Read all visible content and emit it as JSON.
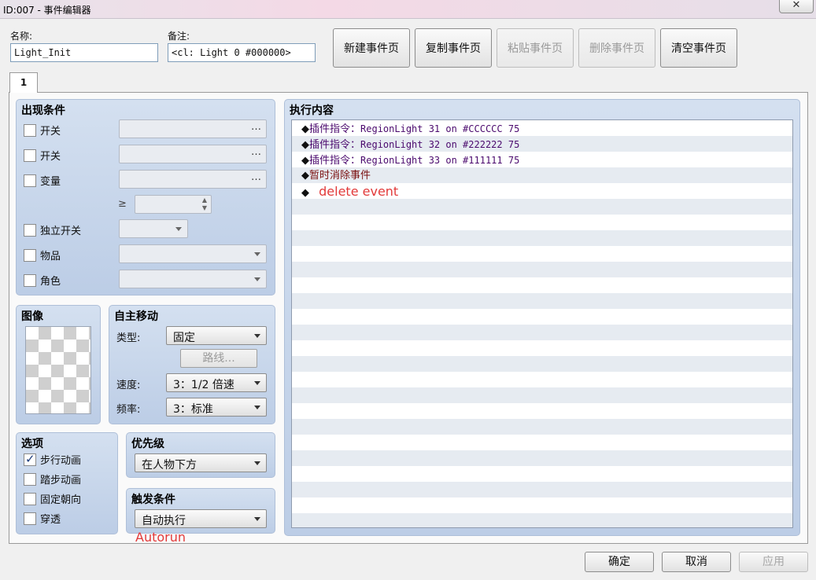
{
  "window": {
    "title": "ID:007 - 事件编辑器",
    "close_glyph": "✕"
  },
  "header": {
    "name_label": "名称:",
    "name_value": "Light_Init",
    "note_label": "备注:",
    "note_value": "<cl: Light 0 #000000>",
    "buttons": [
      {
        "label": "新建事件页",
        "enabled": true
      },
      {
        "label": "复制事件页",
        "enabled": true
      },
      {
        "label": "粘贴事件页",
        "enabled": false
      },
      {
        "label": "删除事件页",
        "enabled": false
      },
      {
        "label": "清空事件页",
        "enabled": true
      }
    ]
  },
  "tabs": [
    {
      "label": "1",
      "selected": true
    }
  ],
  "conditions": {
    "title": "出现条件",
    "switch1_label": "开关",
    "switch2_label": "开关",
    "variable_label": "变量",
    "gte_symbol": "≥",
    "self_switch_label": "独立开关",
    "item_label": "物品",
    "actor_label": "角色",
    "ellipsis": "…"
  },
  "image": {
    "title": "图像"
  },
  "autonomous": {
    "title": "自主移动",
    "type_label": "类型:",
    "type_value": "固定",
    "route_label": "路线...",
    "speed_label": "速度:",
    "speed_value": "3：1/2 倍速",
    "freq_label": "频率:",
    "freq_value": "3：标准"
  },
  "options": {
    "title": "选项",
    "walking": {
      "label": "步行动画",
      "checked": true
    },
    "stepping": {
      "label": "踏步动画",
      "checked": false
    },
    "direction_fix": {
      "label": "固定朝向",
      "checked": false
    },
    "through": {
      "label": "穿透",
      "checked": false
    }
  },
  "priority": {
    "title": "优先级",
    "value": "在人物下方"
  },
  "trigger": {
    "title": "触发条件",
    "value": "自动执行",
    "annotation": "Autorun"
  },
  "contents": {
    "title": "执行内容",
    "commands": [
      {
        "marker": "◆",
        "prefix": "插件指令：",
        "text": "RegionLight 31 on #CCCCCC 75"
      },
      {
        "marker": "◆",
        "prefix": "插件指令：",
        "text": "RegionLight 32 on #222222 75"
      },
      {
        "marker": "◆",
        "prefix": "插件指令：",
        "text": "RegionLight 33 on #111111 75"
      },
      {
        "marker": "◆",
        "text": "暂时消除事件"
      },
      {
        "marker": "◆",
        "annotation": "delete event"
      }
    ]
  },
  "footer": {
    "ok": "确定",
    "cancel": "取消",
    "apply": "应用"
  },
  "colors": {
    "panel_bg": "#c8d6ea",
    "plugin_text": "#4b0a6e",
    "erase_text": "#7a1010",
    "annotation": "#e23a3a"
  }
}
